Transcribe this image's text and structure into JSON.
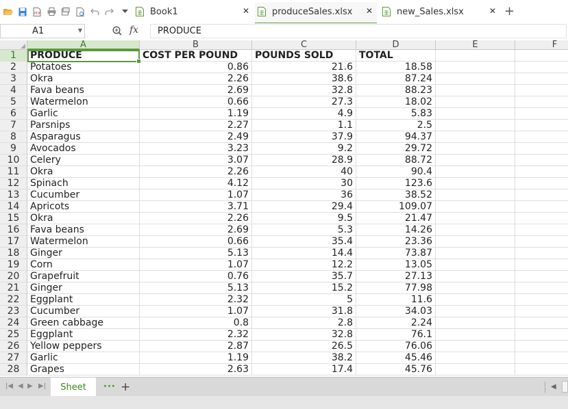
{
  "toolbar": {
    "icons": [
      "open-folder-icon",
      "save-icon",
      "export-pdf-icon",
      "print-icon",
      "print-preview-icon",
      "print-setup-icon",
      "undo-icon",
      "redo-icon",
      "more-icon"
    ]
  },
  "tabs": [
    {
      "label": "Book1",
      "active": false
    },
    {
      "label": "produceSales.xlsx",
      "active": true
    },
    {
      "label": "new_Sales.xlsx",
      "active": false
    }
  ],
  "tab_close_glyph": "✕",
  "tab_add_glyph": "+",
  "formula_bar": {
    "cell_ref": "A1",
    "fx_label": "fx",
    "content": "PRODUCE"
  },
  "columns": [
    "A",
    "B",
    "C",
    "D",
    "E",
    "F"
  ],
  "rows": [
    [
      "PRODUCE",
      "COST PER POUND",
      "POUNDS SOLD",
      "TOTAL"
    ],
    [
      "Potatoes",
      "0.86",
      "21.6",
      "18.58"
    ],
    [
      "Okra",
      "2.26",
      "38.6",
      "87.24"
    ],
    [
      "Fava beans",
      "2.69",
      "32.8",
      "88.23"
    ],
    [
      "Watermelon",
      "0.66",
      "27.3",
      "18.02"
    ],
    [
      "Garlic",
      "1.19",
      "4.9",
      "5.83"
    ],
    [
      "Parsnips",
      "2.27",
      "1.1",
      "2.5"
    ],
    [
      "Asparagus",
      "2.49",
      "37.9",
      "94.37"
    ],
    [
      "Avocados",
      "3.23",
      "9.2",
      "29.72"
    ],
    [
      "Celery",
      "3.07",
      "28.9",
      "88.72"
    ],
    [
      "Okra",
      "2.26",
      "40",
      "90.4"
    ],
    [
      "Spinach",
      "4.12",
      "30",
      "123.6"
    ],
    [
      "Cucumber",
      "1.07",
      "36",
      "38.52"
    ],
    [
      "Apricots",
      "3.71",
      "29.4",
      "109.07"
    ],
    [
      "Okra",
      "2.26",
      "9.5",
      "21.47"
    ],
    [
      "Fava beans",
      "2.69",
      "5.3",
      "14.26"
    ],
    [
      "Watermelon",
      "0.66",
      "35.4",
      "23.36"
    ],
    [
      "Ginger",
      "5.13",
      "14.4",
      "73.87"
    ],
    [
      "Corn",
      "1.07",
      "12.2",
      "13.05"
    ],
    [
      "Grapefruit",
      "0.76",
      "35.7",
      "27.13"
    ],
    [
      "Ginger",
      "5.13",
      "15.2",
      "77.98"
    ],
    [
      "Eggplant",
      "2.32",
      "5",
      "11.6"
    ],
    [
      "Cucumber",
      "1.07",
      "31.8",
      "34.03"
    ],
    [
      "Green cabbage",
      "0.8",
      "2.8",
      "2.24"
    ],
    [
      "Eggplant",
      "2.32",
      "32.8",
      "76.1"
    ],
    [
      "Yellow peppers",
      "2.87",
      "26.5",
      "76.06"
    ],
    [
      "Garlic",
      "1.19",
      "38.2",
      "45.46"
    ],
    [
      "Grapes",
      "2.63",
      "17.4",
      "45.76"
    ]
  ],
  "sheet_tabs": [
    {
      "label": "Sheet",
      "active": true
    }
  ],
  "sheet_menu_glyph": "···",
  "sheet_add_glyph": "+",
  "colors": {
    "accent": "#5a9a3a",
    "selected_header_bg": "#d7e8cd",
    "sheet_tab_text": "#3d8a1f"
  }
}
